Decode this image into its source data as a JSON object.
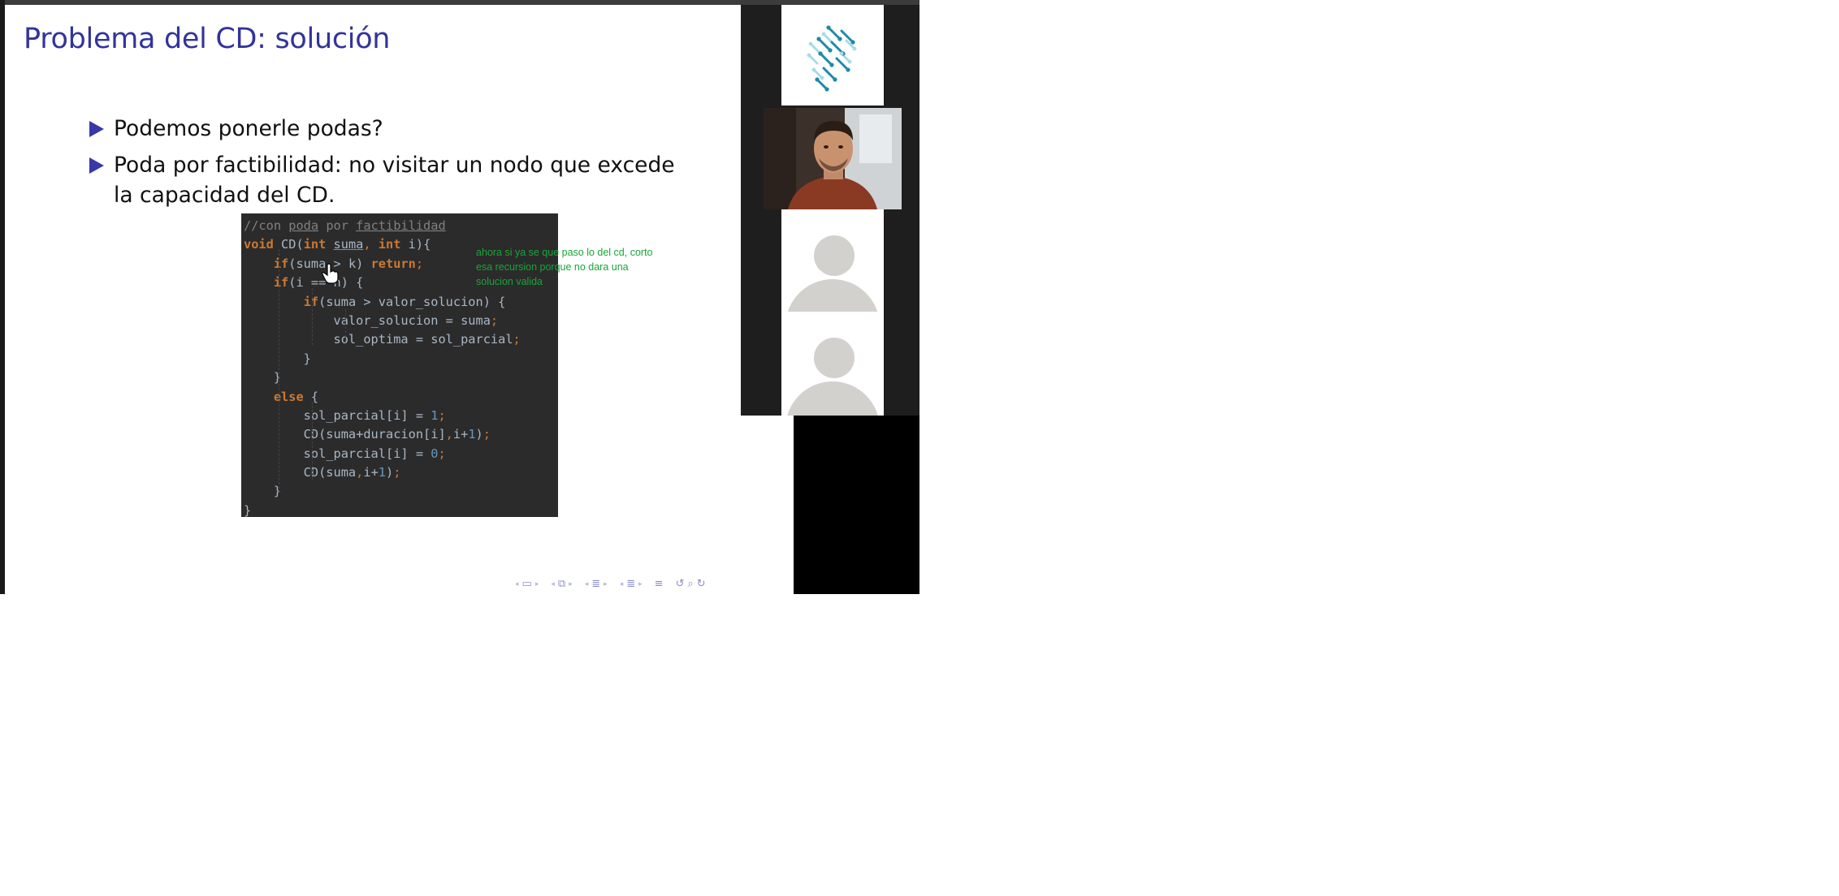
{
  "slide": {
    "title": "Problema del CD: solución",
    "bullets": [
      "Podemos ponerle podas?",
      "Poda por factibilidad: no visitar un nodo que excede la capacidad del CD."
    ],
    "code": {
      "comment": "//con poda por factibilidad",
      "comment_parts": [
        "//con ",
        "poda",
        " por ",
        "factibilidad"
      ]
    },
    "annotation": "ahora si ya se que paso lo del cd, corto esa recursion porque no dara una solucion valida"
  },
  "participants": {
    "count": 4
  },
  "colors": {
    "title": "#33339c",
    "bullet": "#3838a8",
    "code_bg": "#2b2b2b",
    "annotation": "#19a538",
    "participants_bg": "#1e1e1e"
  },
  "icons": [
    "hand-cursor-icon",
    "nav-arrows",
    "avatar-placeholder-icon",
    "logo-dots-icon"
  ]
}
